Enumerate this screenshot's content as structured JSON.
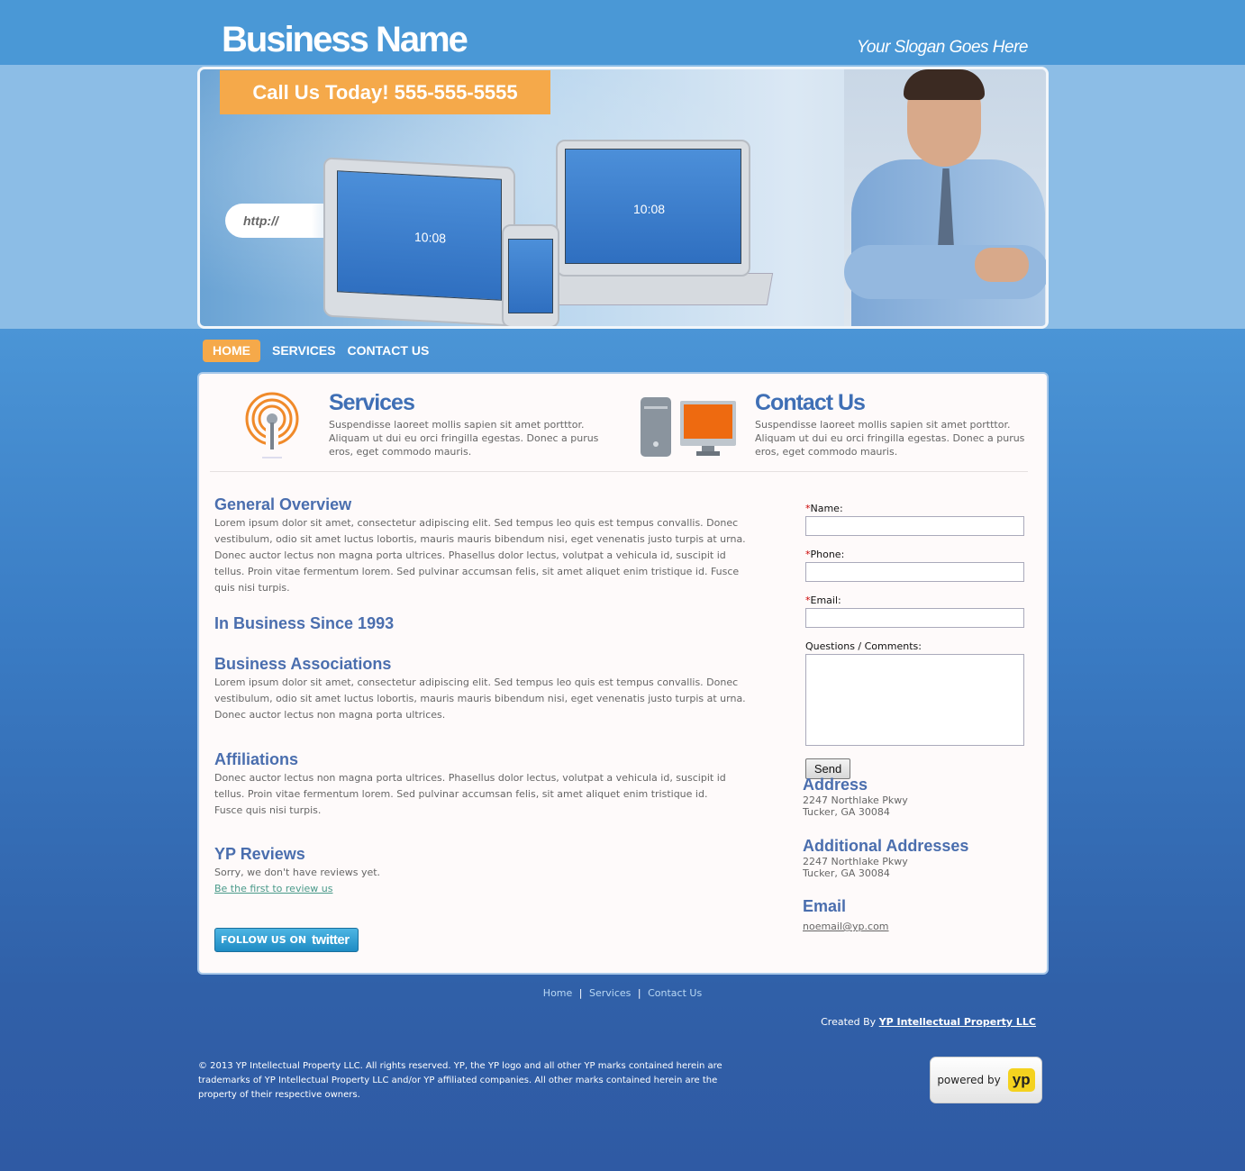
{
  "header": {
    "brand": "Business Name",
    "slogan": "Your Slogan Goes Here"
  },
  "banner": {
    "call_text": "Call Us Today!  555-555-5555",
    "url_text": "http://",
    "tablet_clock": "10:08",
    "laptop_clock": "10:08"
  },
  "nav": {
    "items": [
      {
        "label": "HOME",
        "active": true
      },
      {
        "label": "SERVICES",
        "active": false
      },
      {
        "label": "CONTACT US",
        "active": false
      }
    ]
  },
  "features": {
    "services": {
      "title": "Services",
      "text": "Suspendisse laoreet mollis sapien sit amet portttor. Aliquam ut dui eu orci fringilla egestas. Donec a purus eros, eget commodo mauris.",
      "icon": "antenna-icon"
    },
    "contact": {
      "title": "Contact Us",
      "text": "Suspendisse laoreet mollis sapien sit amet portttor. Aliquam ut dui eu orci fringilla egestas. Donec a purus eros, eget commodo mauris.",
      "icon": "computer-icon"
    }
  },
  "main": {
    "overview_title": "General Overview",
    "overview_text": "Lorem ipsum dolor sit amet, consectetur adipiscing elit. Sed tempus leo quis est tempus convallis. Donec vestibulum, odio sit amet luctus lobortis, mauris mauris bibendum nisi, eget venenatis justo turpis at urna. Donec auctor lectus non magna porta ultrices. Phasellus dolor lectus, volutpat a vehicula id, suscipit id tellus. Proin vitae fermentum lorem. Sed pulvinar accumsan felis, sit amet aliquet enim tristique id. Fusce quis nisi turpis.",
    "since_title": "In Business Since 1993",
    "assoc_title": "Business Associations",
    "assoc_text": "Lorem ipsum dolor sit amet, consectetur adipiscing elit. Sed tempus leo quis est tempus convallis. Donec vestibulum, odio sit amet luctus lobortis, mauris mauris bibendum nisi, eget venenatis justo turpis at urna. Donec auctor lectus non magna porta ultrices.",
    "affil_title": "Affiliations",
    "affil_text": "Donec auctor lectus non magna porta ultrices. Phasellus dolor lectus, volutpat a vehicula id, suscipit id tellus. Proin vitae fermentum lorem. Sed pulvinar accumsan felis, sit amet aliquet enim tristique id. Fusce quis nisi turpis.",
    "reviews_title": "YP Reviews",
    "reviews_text": "Sorry, we don't have reviews yet.",
    "reviews_link": "Be the first to review us",
    "twitter_prefix": "FOLLOW US ON",
    "twitter_brand": "twitter"
  },
  "form": {
    "required_mark": "*",
    "name_label": "Name:",
    "phone_label": "Phone:",
    "email_label": "Email:",
    "comments_label": "Questions / Comments:",
    "name_value": "",
    "phone_value": "",
    "email_value": "",
    "comments_value": "",
    "send_label": "Send"
  },
  "sidebar": {
    "address_title": "Address",
    "address_line1": "2247 Northlake Pkwy",
    "address_line2": "Tucker, GA 30084",
    "additional_title": "Additional Addresses",
    "additional_line1": "2247 Northlake Pkwy",
    "additional_line2": "Tucker, GA 30084",
    "email_title": "Email",
    "email_value": "noemail@yp.com"
  },
  "footer": {
    "links": [
      "Home",
      "Services",
      "Contact Us"
    ],
    "separator": "|",
    "created_prefix": "Created By",
    "created_by": "YP Intellectual Property LLC",
    "copyright": "© 2013  YP Intellectual Property LLC. All rights reserved. YP, the YP logo and all other YP marks contained herein are trademarks of YP Intellectual Property LLC and/or YP affiliated companies. All other marks contained herein are the property of their respective owners.",
    "powered_by": "powered by",
    "yp_logo": "yp"
  },
  "colors": {
    "accent_orange": "#f5a94a",
    "heading_blue": "#4a6eae",
    "bg_blue": "#4a98d6"
  }
}
